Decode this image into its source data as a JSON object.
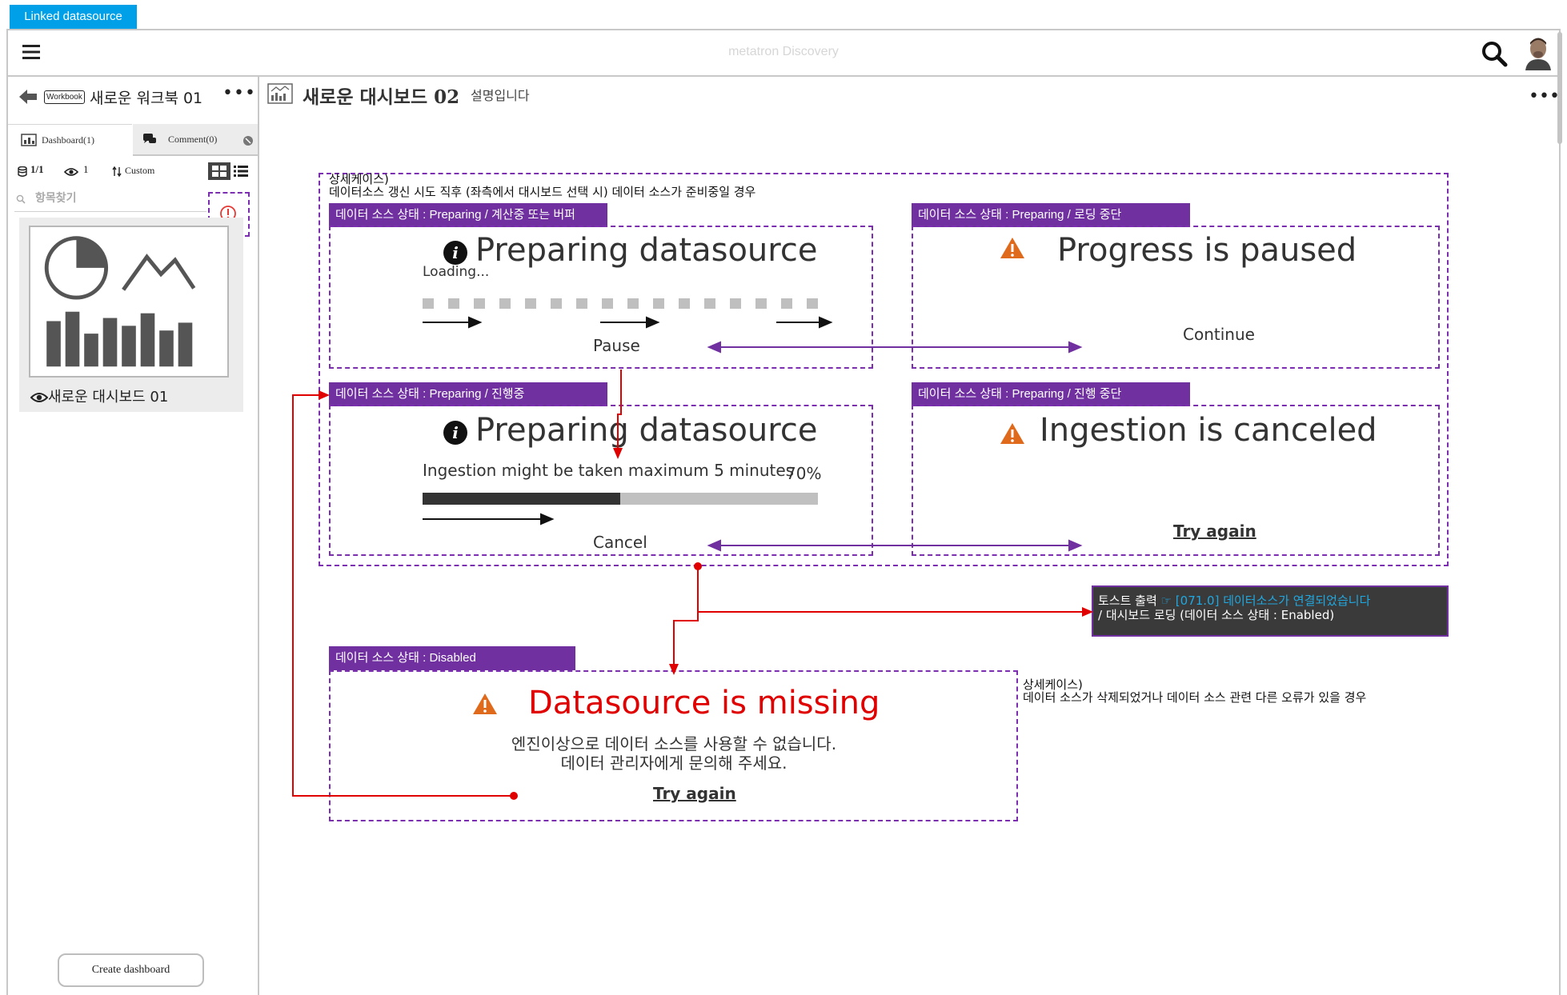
{
  "top_tab": {
    "label": "Linked datasource"
  },
  "app": {
    "name": "metatron Discovery"
  },
  "sidebar": {
    "workbook_badge": "Workbook",
    "workbook_name": "새로운 워크북 01",
    "more_label": "•••",
    "tabs": [
      {
        "label": "Dashboard(1)"
      },
      {
        "label": "Comment(0)"
      }
    ],
    "page_count": "1/1",
    "view_count": "1",
    "sort_label": "Custom",
    "search_placeholder": "항목찾기",
    "dashboard_item": {
      "name": "새로운 대시보드 01"
    },
    "create_button": "Create dashboard"
  },
  "main": {
    "title_korean": "새로운 대시보드",
    "title_number": "02",
    "description": "설명입니다",
    "more_label": "•••"
  },
  "annotations": {
    "detail_case_top": {
      "heading": "상세케이스)",
      "text": "데이터소스 갱신 시도 직후 (좌측에서 대시보드 선택 시) 데이터 소스가 준비중일 경우"
    },
    "state_preparing_buffer": {
      "label": "데이터 소스 상태 : Preparing / 계산중 또는 버퍼",
      "title": "Preparing datasource",
      "loading": "Loading...",
      "action": "Pause"
    },
    "state_paused": {
      "label": "데이터 소스 상태 : Preparing / 로딩 중단",
      "title": "Progress is paused",
      "action": "Continue"
    },
    "state_progress": {
      "label": "데이터 소스 상태 : Preparing / 진행중",
      "title": "Preparing datasource",
      "message": "Ingestion might be taken maximum 5 minutes",
      "percent": "70%",
      "progress_value": 0.5,
      "action": "Cancel"
    },
    "state_canceled": {
      "label": "데이터 소스 상태 : Preparing / 진행 중단",
      "title": "Ingestion is canceled",
      "action": "Try again"
    },
    "toast": {
      "prefix": "토스트 출력",
      "arrow": "☞",
      "message": "[071.0] 데이터소스가 연결되었습니다",
      "line2": "/ 대시보드 로딩 (데이터 소스 상태 : Enabled)"
    },
    "state_disabled": {
      "label": "데이터 소스 상태 : Disabled",
      "title": "Datasource is missing",
      "line1": "엔진이상으로 데이터 소스를 사용할 수 없습니다.",
      "line2": "데이터 관리자에게 문의해 주세요.",
      "action": "Try again"
    },
    "detail_case_bottom": {
      "heading": "상세케이스)",
      "text": "데이터 소스가 삭제되었거나 데이터 소스 관련 다른 오류가 있을 경우"
    }
  },
  "colors": {
    "accent_blue": "#00a0e9",
    "annotation_purple": "#7030a0",
    "flow_red": "#e00000",
    "error_red": "#e00000",
    "warning_orange": "#e06a1c"
  },
  "icons": [
    "menu-icon",
    "search-icon",
    "avatar",
    "back-arrow-icon",
    "dashboard-icon",
    "comment-icon",
    "db-icon",
    "eye-icon",
    "sort-icon",
    "grid-view-icon",
    "list-view-icon",
    "search-small-icon",
    "alert-icon",
    "info-icon",
    "warning-icon"
  ]
}
